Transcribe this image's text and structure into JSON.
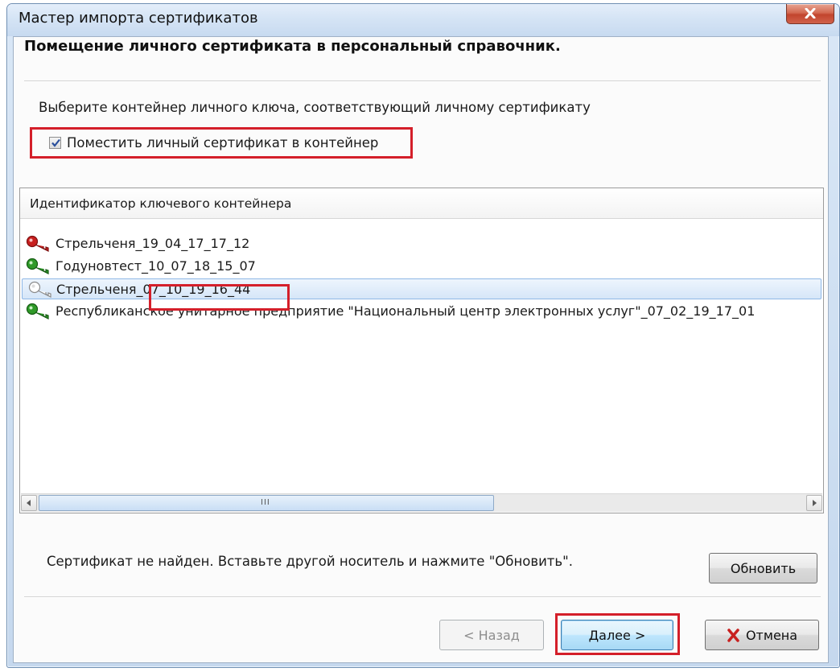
{
  "window": {
    "title": "Мастер импорта сертификатов"
  },
  "header": {
    "title": "Помещение личного сертификата в персональный справочник."
  },
  "instruction": "Выберите контейнер личного ключа, соответствующий личному сертификату",
  "checkbox": {
    "label": "Поместить личный сертификат в контейнер",
    "checked": true
  },
  "list": {
    "column_header": "Идентификатор ключевого контейнера",
    "items": [
      {
        "label": "Стрельченя_19_04_17_17_12",
        "icon": "red-key-icon"
      },
      {
        "label": "Годуновтест_10_07_18_15_07",
        "icon": "green-key-icon"
      },
      {
        "label": "Стрельченя_07_10_19_16_44",
        "icon": "white-key-icon",
        "selected": true
      },
      {
        "label": "Республиканское унитарное предприятие \"Национальный центр электронных услуг\"_07_02_19_17_01",
        "icon": "green-key-icon"
      }
    ],
    "scroll_grip": "III"
  },
  "status": {
    "message": "Сертификат не найден. Вставьте другой носитель и нажмите \"Обновить\"."
  },
  "buttons": {
    "refresh": "Обновить",
    "back": "< Назад",
    "next": "Далее >",
    "cancel": "Отмена"
  },
  "colors": {
    "highlight_red": "#d41f2a",
    "selection_border": "#8fb8e6",
    "key_red": "#c8201f",
    "key_green": "#2f9a28"
  }
}
